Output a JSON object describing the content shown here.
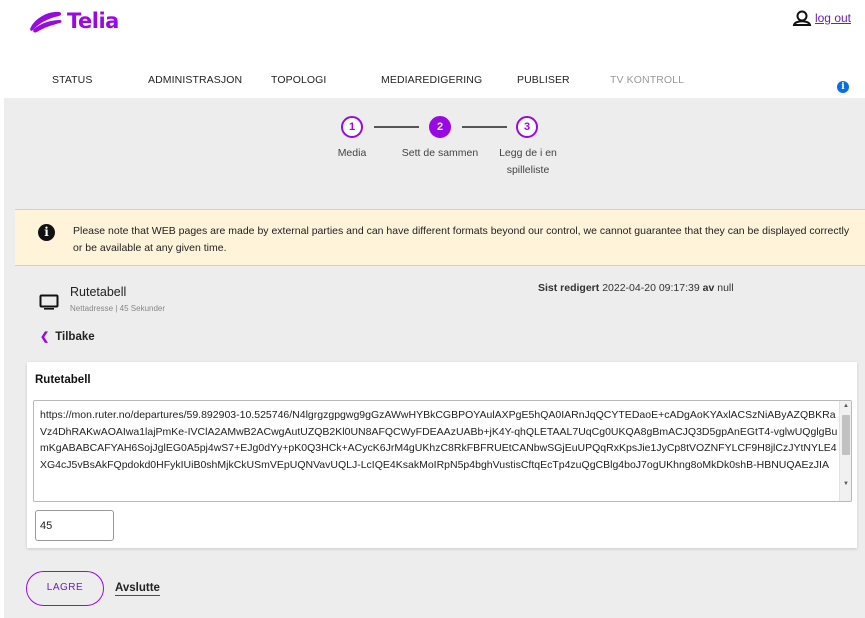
{
  "header": {
    "brand": "Telia",
    "logout_label": "log out"
  },
  "nav": {
    "items": [
      {
        "label": "STATUS"
      },
      {
        "label": "ADMINISTRASJON"
      },
      {
        "label": "TOPOLOGI"
      },
      {
        "label": "MEDIAREDIGERING"
      },
      {
        "label": "PUBLISER"
      },
      {
        "label": "TV KONTROLL"
      }
    ],
    "active": "MEDIAREDIGERING",
    "disabled": "TV KONTROLL"
  },
  "stepper": {
    "steps": [
      {
        "number": "1",
        "label": "Media",
        "state": "done"
      },
      {
        "number": "2",
        "label": "Sett de sammen",
        "state": "current"
      },
      {
        "number": "3",
        "label": "Legg de i en spilleliste",
        "state": "pending"
      }
    ]
  },
  "notice": {
    "text": "Please note that WEB pages are made by external parties and can have different formats beyond our control, we cannot guarantee that they can be displayed correctly or be available at any given time."
  },
  "item": {
    "title": "Rutetabell",
    "subtitle": "Nettadresse | 45 Sekunder",
    "last_edited_label": "Sist redigert",
    "last_edited_value": "2022-04-20 09:17:39",
    "by_label": "av",
    "by_value": "null"
  },
  "back_label": "Tilbake",
  "panel": {
    "title": "Rutetabell",
    "url": "https://mon.ruter.no/departures/59.892903-10.525746/N4lgrgzgpgwg9gGzAWwHYBkCGBPOYAulAXPgE5hQA0IARnJqQCYTEDaoE+cADgAoKYAxlACSzNiAByAZQBKRaVz4DhRAKwAOAIwa1lajPmKe-IVClA2AMwB2ACwgAutUZQB2Kl0UN8AFQCWyFDEAAzUABb+jK4Y-qhQLETAAL7UqCg0UKQA8gBmACJQ3D5gpAnEGtT4-vglwUQglgBumKgABABCAFYAH6SojJglEG0A5pj4wS7+EJg0dYy+pK0Q3HCk+ACycK6JrM4gUKhzC8RkFBFRUEtCANbwSGjEuUPQqRxKpsJie1JyCp8tVOZNFYLCF9H8jlCzJYtNYLE4XG4cJ5vBsAkFQpdokd0HFykIUiB0shMjkCkUSmVEpUQNVavUQLJ-LcIQE4KsakMoIRpN5p4bghVustisCftqEcTp4zuQgCBlg4boJ7ogUKhng8oMkDk0shB-HBNUQAEzJIA",
    "duration": "45",
    "scroll_up_icon": "▲",
    "scroll_down_icon": "▼"
  },
  "footer": {
    "save_label": "LAGRE",
    "exit_label": "Avslutte"
  },
  "colors": {
    "brand": "#990ae3",
    "info": "#0a6ee3",
    "notice_bg": "#fff3da",
    "content_bg": "#ededed"
  },
  "icons": {
    "logo": "telia-pebble-logo",
    "user": "user-icon",
    "info": "info-icon",
    "monitor": "monitor-icon",
    "back": "chevron-left-icon"
  }
}
